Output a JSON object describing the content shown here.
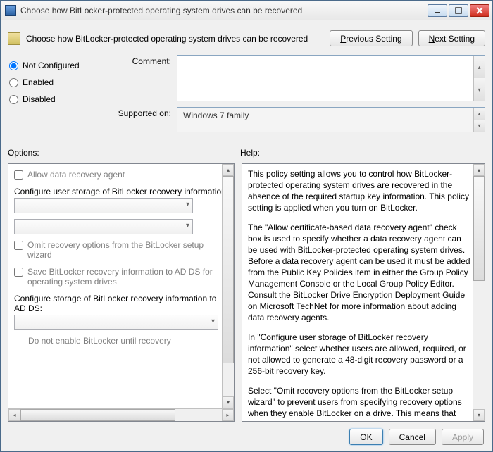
{
  "window": {
    "title": "Choose how BitLocker-protected operating system drives can be recovered"
  },
  "header": {
    "text": "Choose how BitLocker-protected operating system drives can be recovered",
    "prev_letter": "P",
    "prev_rest": "revious Setting",
    "next_letter": "N",
    "next_rest": "ext Setting"
  },
  "radios": {
    "not_configured": "Not Configured",
    "enabled": "Enabled",
    "disabled": "Disabled"
  },
  "fields": {
    "comment_label": "Comment:",
    "supported_label": "Supported on:",
    "supported_value": "Windows 7 family"
  },
  "sections": {
    "options": "Options:",
    "help": "Help:"
  },
  "options": {
    "allow_agent": "Allow data recovery agent",
    "configure_user_storage": "Configure user storage of BitLocker recovery information:",
    "omit_recovery": "Omit recovery options from the BitLocker setup wizard",
    "save_ad": "Save BitLocker recovery information to AD DS for operating system drives",
    "configure_ad_storage": "Configure storage of BitLocker recovery information to AD DS:",
    "do_not_enable": "Do not enable BitLocker until recovery"
  },
  "help": {
    "p1": "This policy setting allows you to control how BitLocker-protected operating system drives are recovered in the absence of the required startup key information. This policy setting is applied when you turn on BitLocker.",
    "p2": "The \"Allow certificate-based data recovery agent\" check box is used to specify whether a data recovery agent can be used with BitLocker-protected operating system drives. Before a data recovery agent can be used it must be added from the Public Key Policies item in either the Group Policy Management Console or the Local Group Policy Editor. Consult the BitLocker Drive Encryption Deployment Guide on Microsoft TechNet for more information about adding data recovery agents.",
    "p3": "In \"Configure user storage of BitLocker recovery information\" select whether users are allowed, required, or not allowed to generate a 48-digit recovery password or a 256-bit recovery key.",
    "p4": "Select \"Omit recovery options from the BitLocker setup wizard\" to prevent users from specifying recovery options when they enable BitLocker on a drive. This means that you will not be able"
  },
  "footer": {
    "ok": "OK",
    "cancel": "Cancel",
    "apply": "Apply"
  }
}
